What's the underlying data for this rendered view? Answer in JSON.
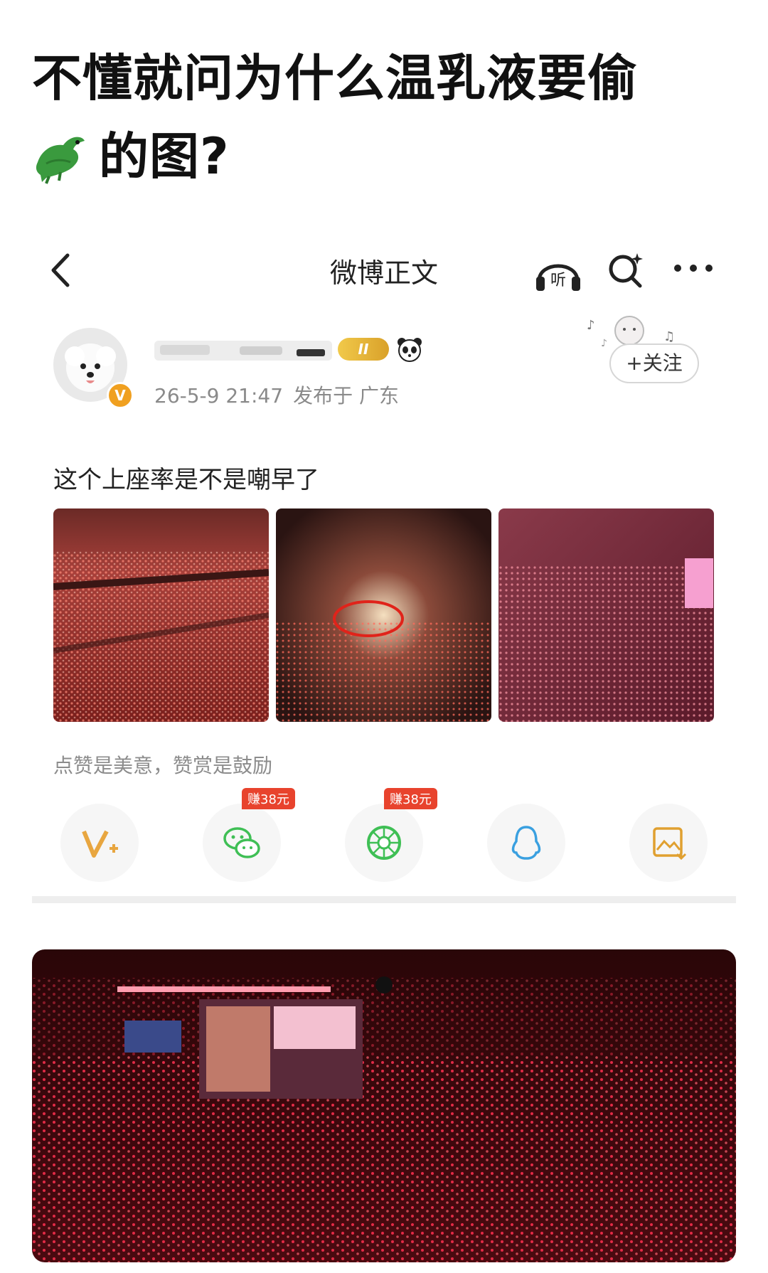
{
  "headline": {
    "line1": "不懂就问为什么温乳液要偷",
    "line2": "的图?"
  },
  "weibo": {
    "nav": {
      "title": "微博正文",
      "listen_icon_label": "听"
    },
    "post": {
      "level_badge": "II",
      "time": "26-5-9 21:47",
      "location": "发布于 广东",
      "follow_label": "+关注",
      "text": "这个上座率是不是嘲早了",
      "v_badge": "V"
    },
    "tip": "点赞是美意，赞赏是鼓励",
    "shares": [
      {
        "name": "vplus",
        "badge": ""
      },
      {
        "name": "wechat",
        "badge": "赚38元"
      },
      {
        "name": "moments",
        "badge": "赚38元"
      },
      {
        "name": "qq",
        "badge": ""
      },
      {
        "name": "save-image",
        "badge": ""
      }
    ]
  }
}
